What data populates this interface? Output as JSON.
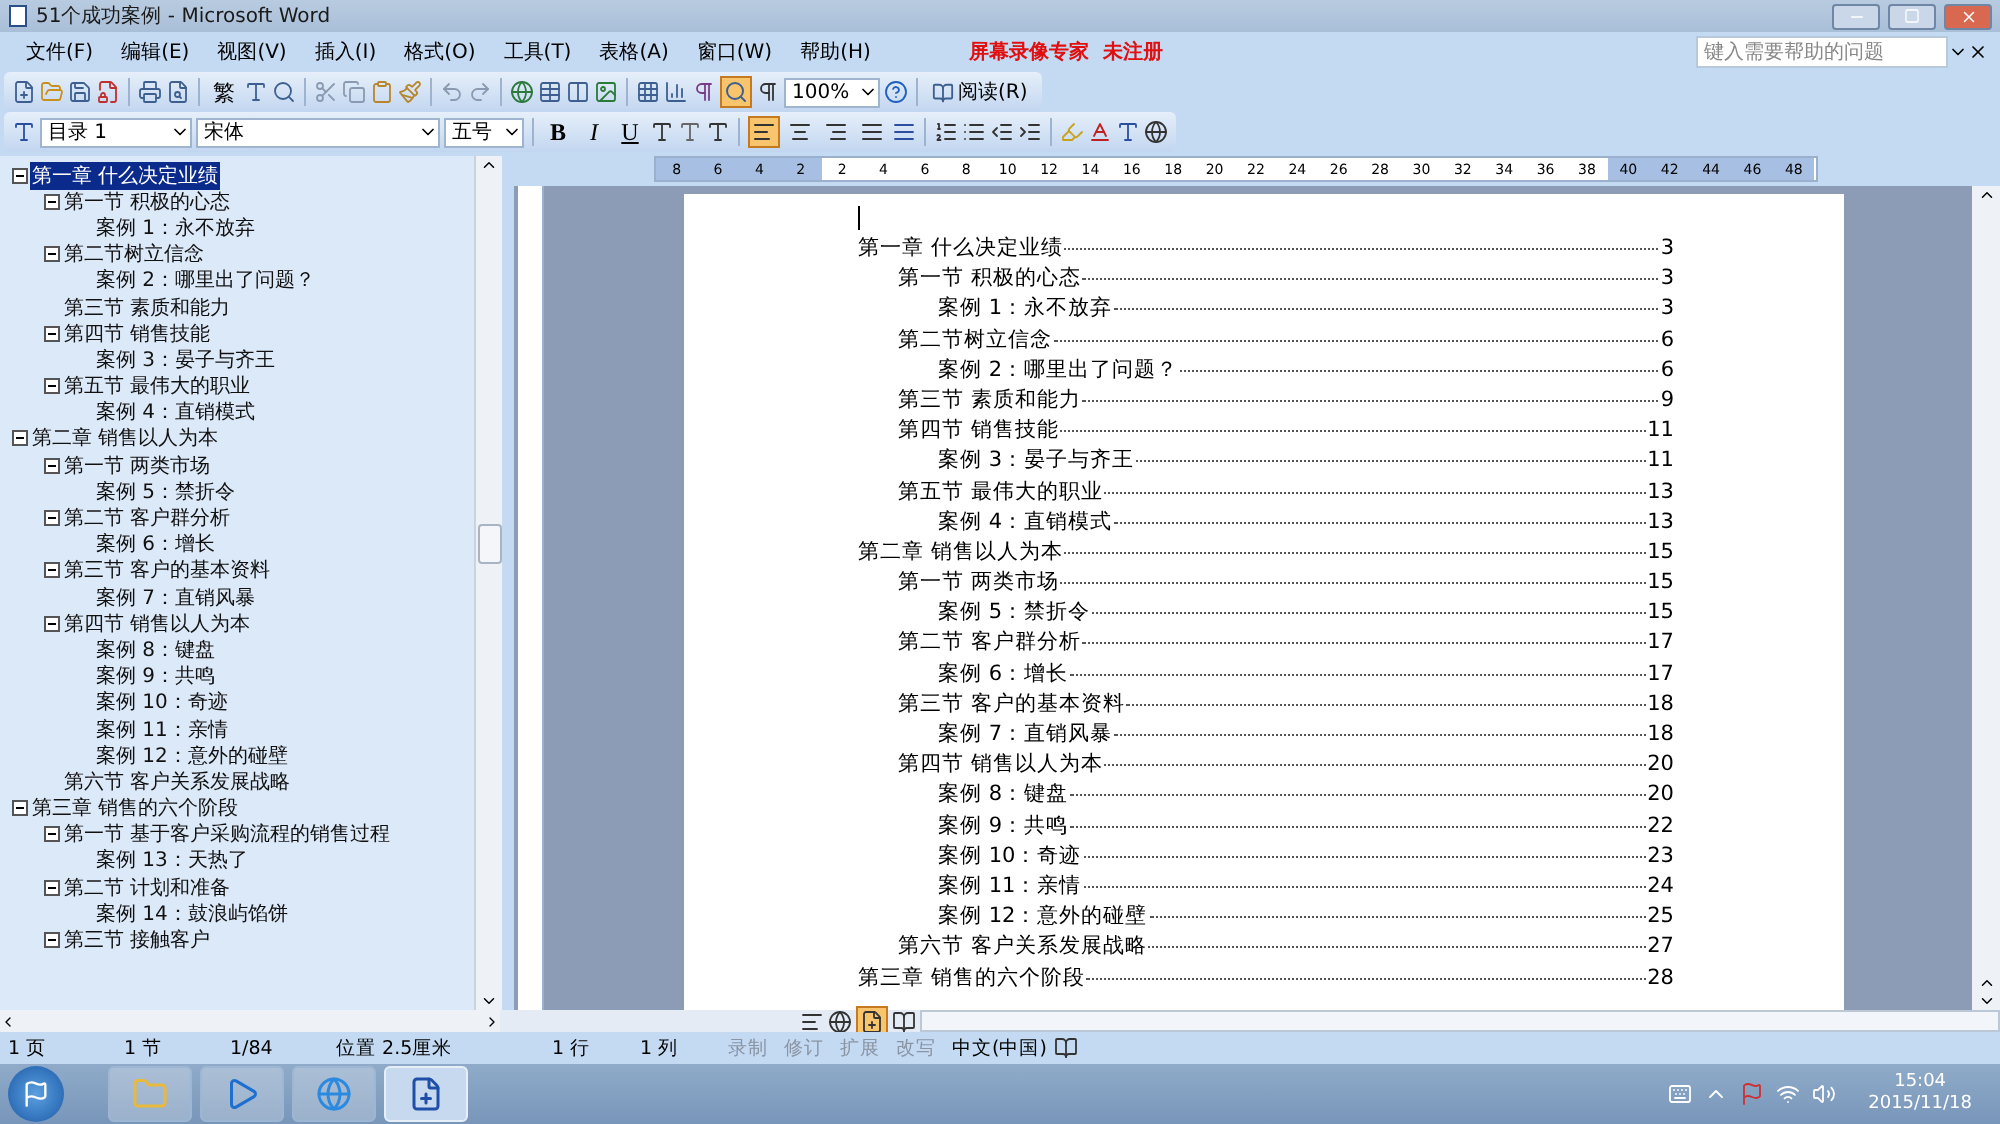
{
  "window": {
    "title": "51个成功案例 - Microsoft Word"
  },
  "menu": {
    "items": [
      {
        "label": "文件(F)"
      },
      {
        "label": "编辑(E)"
      },
      {
        "label": "视图(V)"
      },
      {
        "label": "插入(I)"
      },
      {
        "label": "格式(O)"
      },
      {
        "label": "工具(T)"
      },
      {
        "label": "表格(A)"
      },
      {
        "label": "窗口(W)"
      },
      {
        "label": "帮助(H)"
      }
    ],
    "recorder_notice": "屏幕录像专家  未注册",
    "help_placeholder": "键入需要帮助的问题"
  },
  "standard_toolbar": {
    "traditional_label": "繁",
    "zoom": "100%",
    "read_button": "阅读(R)"
  },
  "format_toolbar": {
    "style": "目录 1",
    "font": "宋体",
    "size": "五号",
    "bold": "B",
    "italic": "I",
    "underline": "U",
    "alignment": [
      {
        "selected": true
      },
      {
        "selected": false
      },
      {
        "selected": false
      },
      {
        "selected": false
      }
    ]
  },
  "outline": {
    "items": [
      {
        "text": "第一章  什么决定业绩",
        "selected": true,
        "expanded": true,
        "children": [
          {
            "text": "第一节  积极的心态",
            "selected": false,
            "expanded": true,
            "children": [
              {
                "text": "案例 1：永不放弃",
                "selected": false,
                "expanded": false
              }
            ]
          },
          {
            "text": "第二节树立信念",
            "selected": false,
            "expanded": true,
            "children": [
              {
                "text": "案例 2：哪里出了问题？",
                "selected": false,
                "expanded": false
              }
            ]
          },
          {
            "text": "第三节  素质和能力",
            "selected": false,
            "expanded": false
          },
          {
            "text": "第四节  销售技能",
            "selected": false,
            "expanded": true,
            "children": [
              {
                "text": "案例 3：晏子与齐王",
                "selected": false,
                "expanded": false
              }
            ]
          },
          {
            "text": "第五节  最伟大的职业",
            "selected": false,
            "expanded": true,
            "children": [
              {
                "text": "案例 4：直销模式",
                "selected": false,
                "expanded": false
              }
            ]
          }
        ]
      },
      {
        "text": "第二章  销售以人为本",
        "selected": false,
        "expanded": true,
        "children": [
          {
            "text": "第一节  两类市场",
            "selected": false,
            "expanded": true,
            "children": [
              {
                "text": "案例 5：禁折令",
                "selected": false,
                "expanded": false
              }
            ]
          },
          {
            "text": "第二节  客户群分析",
            "selected": false,
            "expanded": true,
            "children": [
              {
                "text": "案例 6：增长",
                "selected": false,
                "expanded": false
              }
            ]
          },
          {
            "text": "第三节  客户的基本资料",
            "selected": false,
            "expanded": true,
            "children": [
              {
                "text": "案例 7：直销风暴",
                "selected": false,
                "expanded": false
              }
            ]
          },
          {
            "text": "第四节  销售以人为本",
            "selected": false,
            "expanded": true,
            "children": [
              {
                "text": "案例 8：键盘",
                "selected": false,
                "expanded": false
              },
              {
                "text": "案例 9：共鸣",
                "selected": false,
                "expanded": false
              },
              {
                "text": "案例 10：奇迹",
                "selected": false,
                "expanded": false
              },
              {
                "text": "案例 11：亲情",
                "selected": false,
                "expanded": false
              },
              {
                "text": "案例 12：意外的碰壁",
                "selected": false,
                "expanded": false
              }
            ]
          },
          {
            "text": "第六节  客户关系发展战略",
            "selected": false,
            "expanded": false
          }
        ]
      },
      {
        "text": "第三章  销售的六个阶段",
        "selected": false,
        "expanded": true,
        "children": [
          {
            "text": "第一节  基于客户采购流程的销售过程",
            "selected": false,
            "expanded": true,
            "children": [
              {
                "text": "案例 13：天热了",
                "selected": false,
                "expanded": false
              }
            ]
          },
          {
            "text": "第二节  计划和准备",
            "selected": false,
            "expanded": true,
            "children": [
              {
                "text": "案例 14：鼓浪屿馅饼",
                "selected": false,
                "expanded": false
              }
            ]
          },
          {
            "text": "第三节  接触客户",
            "selected": false,
            "expanded": true
          }
        ]
      }
    ]
  },
  "ruler": {
    "left_ticks": [
      "8",
      "6",
      "4",
      "2"
    ],
    "right_ticks": [
      "2",
      "4",
      "6",
      "8",
      "10",
      "12",
      "14",
      "16",
      "18",
      "20",
      "22",
      "24",
      "26",
      "28",
      "30",
      "32",
      "34",
      "36",
      "38",
      "40",
      "42",
      "44",
      "46",
      "48"
    ]
  },
  "document": {
    "toc": [
      {
        "text": "第一章  什么决定业绩",
        "page": "3",
        "children": [
          {
            "text": "第一节  积极的心态",
            "page": "3",
            "children": [
              {
                "text": "案例 1：永不放弃",
                "page": "3"
              }
            ]
          },
          {
            "text": "第二节树立信念",
            "page": "6",
            "children": [
              {
                "text": "案例 2：哪里出了问题？",
                "page": "6"
              }
            ]
          },
          {
            "text": "第三节  素质和能力",
            "page": "9"
          },
          {
            "text": "第四节  销售技能",
            "page": "11",
            "children": [
              {
                "text": "案例 3：晏子与齐王",
                "page": "11"
              }
            ]
          },
          {
            "text": "第五节  最伟大的职业",
            "page": "13",
            "children": [
              {
                "text": "案例 4：直销模式",
                "page": "13"
              }
            ]
          }
        ]
      },
      {
        "text": "第二章  销售以人为本",
        "page": "15",
        "children": [
          {
            "text": "第一节  两类市场",
            "page": "15",
            "children": [
              {
                "text": "案例 5：禁折令",
                "page": "15"
              }
            ]
          },
          {
            "text": "第二节  客户群分析",
            "page": "17",
            "children": [
              {
                "text": "案例 6：增长",
                "page": "17"
              }
            ]
          },
          {
            "text": "第三节  客户的基本资料",
            "page": "18",
            "children": [
              {
                "text": "案例 7：直销风暴",
                "page": "18"
              }
            ]
          },
          {
            "text": "第四节  销售以人为本",
            "page": "20",
            "children": [
              {
                "text": "案例 8：键盘",
                "page": "20"
              },
              {
                "text": "案例 9：共鸣",
                "page": "22"
              },
              {
                "text": "案例 10：奇迹",
                "page": "23"
              },
              {
                "text": "案例 11：亲情",
                "page": "24"
              },
              {
                "text": "案例 12：意外的碰壁",
                "page": "25"
              }
            ]
          },
          {
            "text": "第六节  客户关系发展战略",
            "page": "27"
          }
        ]
      },
      {
        "text": "第三章  销售的六个阶段",
        "page": "28"
      }
    ]
  },
  "status_bar": {
    "page": "1 页",
    "section": "1 节",
    "page_count": "1/84",
    "position": "位置 2.5厘米",
    "line": "1 行",
    "column": "1 列",
    "modes": [
      {
        "label": "录制",
        "disabled": true
      },
      {
        "label": "修订",
        "disabled": true
      },
      {
        "label": "扩展",
        "disabled": true
      },
      {
        "label": "改写",
        "disabled": true
      }
    ],
    "language": "中文(中国)"
  },
  "taskbar": {
    "apps": [
      {
        "selected": false
      },
      {
        "selected": false
      },
      {
        "selected": false
      },
      {
        "selected": true
      }
    ],
    "time": "15:04",
    "date": "2015/11/18"
  }
}
